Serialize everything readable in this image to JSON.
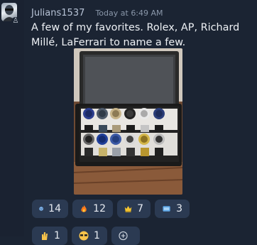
{
  "message": {
    "username": "Julians1537",
    "timestamp": "Today at 6:49 AM",
    "text": "A few of my favorites. Rolex, AP, Richard Millé, LaFerrari to name a few."
  },
  "reactions": [
    {
      "icon": "crying-face-icon",
      "count": "14"
    },
    {
      "icon": "fire-icon",
      "count": "12"
    },
    {
      "icon": "crown-icon",
      "count": "7"
    },
    {
      "icon": "moneybag-icon",
      "count": "3"
    }
  ],
  "reactions_row2": [
    {
      "icon": "hand-icon",
      "count": "1"
    },
    {
      "icon": "sunglasses-icon",
      "count": "1"
    },
    {
      "icon": "add-reaction-icon",
      "count": ""
    }
  ],
  "colors": {
    "background": "#1b2433",
    "reaction_bg": "#2b3a52",
    "username": "#b7c3d6",
    "timestamp": "#8a97aa"
  }
}
